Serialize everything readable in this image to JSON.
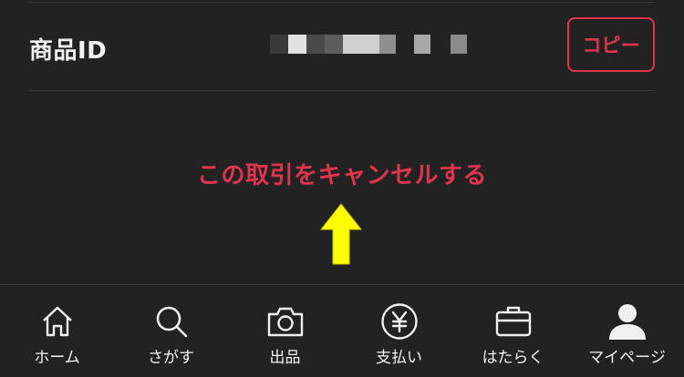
{
  "product_row": {
    "label": "商品ID",
    "copy_label": "コピー"
  },
  "cancel_link": "この取引をキャンセルする",
  "tabbar": {
    "items": [
      {
        "label": "ホーム",
        "icon": "home-icon"
      },
      {
        "label": "さがす",
        "icon": "search-icon"
      },
      {
        "label": "出品",
        "icon": "camera-icon"
      },
      {
        "label": "支払い",
        "icon": "yen-icon"
      },
      {
        "label": "はたらく",
        "icon": "briefcase-icon"
      },
      {
        "label": "マイページ",
        "icon": "user-icon"
      }
    ]
  },
  "colors": {
    "background": "#222222",
    "accent": "#e0344e",
    "arrow": "#ffff00"
  }
}
